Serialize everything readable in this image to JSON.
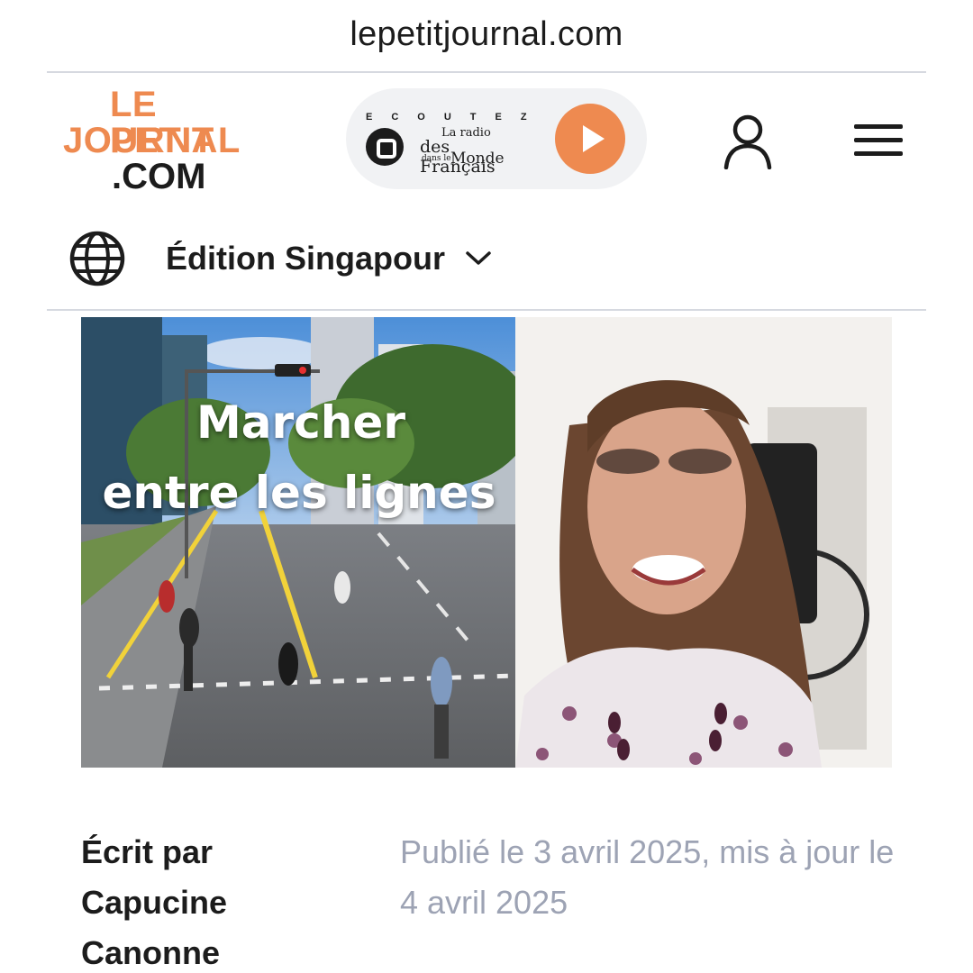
{
  "browser": {
    "url": "lepetitjournal.com"
  },
  "header": {
    "logo": {
      "line1": "LE PETIT",
      "line2": "JOURNAL",
      "line3": ".COM"
    },
    "radio": {
      "ecoutez": "ECOUTEZ",
      "brand_la_radio": "La radio",
      "brand_des_francais": "des Français",
      "brand_dans_le": "dans le",
      "brand_monde": "Monde"
    }
  },
  "edition": {
    "label": "Édition Singapour"
  },
  "article": {
    "image_title_line1": "Marcher",
    "image_title_line2": "entre les lignes",
    "written_by_label": "Écrit par",
    "author_first": "Capucine",
    "author_last": "Canonne",
    "dates": "Publié le 3 avril 2025, mis à jour le 4 avril 2025"
  },
  "colors": {
    "accent": "#ee8a50",
    "text": "#1c1c1c",
    "muted": "#9da3b4",
    "divider": "#d6d9e0"
  },
  "icons": [
    "user-icon",
    "menu-icon",
    "globe-icon",
    "chevron-down-icon",
    "play-icon",
    "radio-logo-icon"
  ]
}
